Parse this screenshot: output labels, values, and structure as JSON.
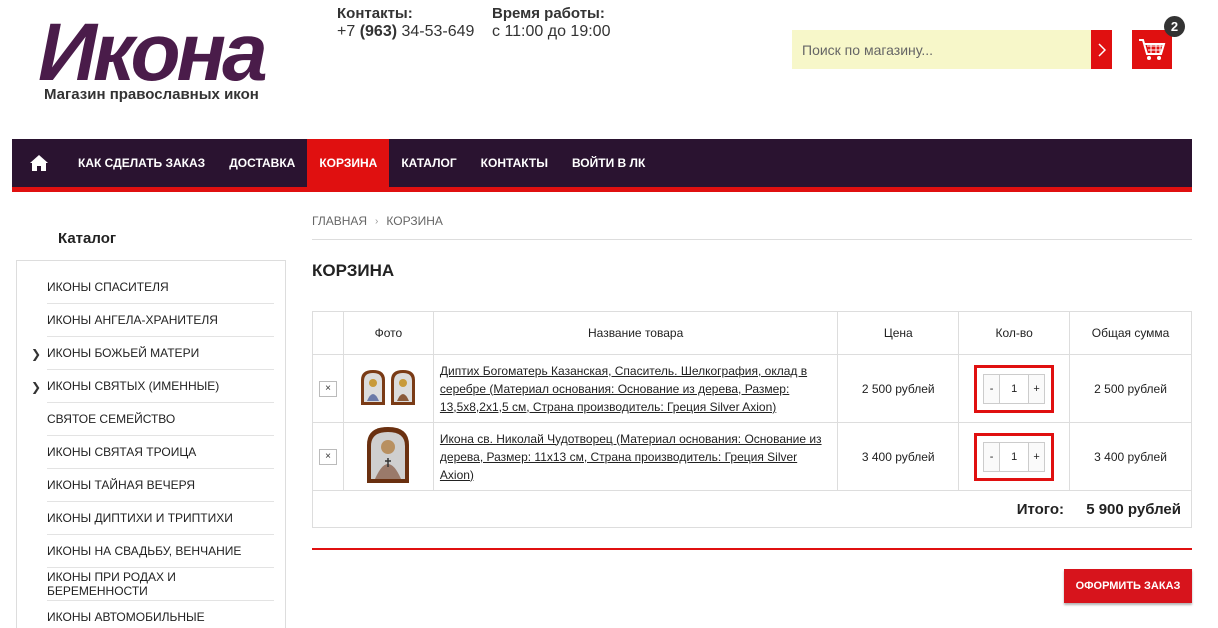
{
  "logo": {
    "title": "Икона",
    "subtitle": "Магазин православных икон"
  },
  "contacts": {
    "label": "Контакты:",
    "phone_prefix": "+7 ",
    "phone_code": "(963)",
    "phone_number": " 34-53-649"
  },
  "hours": {
    "label": "Время работы:",
    "value": "с 11:00 до 19:00"
  },
  "search": {
    "placeholder": "Поиск по магазину..."
  },
  "cart": {
    "count": "2"
  },
  "nav": {
    "items": [
      {
        "label": "КАК СДЕЛАТЬ ЗАКАЗ"
      },
      {
        "label": "ДОСТАВКА"
      },
      {
        "label": "КОРЗИНА"
      },
      {
        "label": "КАТАЛОГ"
      },
      {
        "label": "КОНТАКТЫ"
      },
      {
        "label": "ВОЙТИ В ЛК"
      }
    ]
  },
  "sidebar": {
    "title": "Каталог",
    "items": [
      {
        "label": "ИКОНЫ СПАСИТЕЛЯ"
      },
      {
        "label": "ИКОНЫ АНГЕЛА-ХРАНИТЕЛЯ"
      },
      {
        "label": "ИКОНЫ БОЖЬЕЙ МАТЕРИ"
      },
      {
        "label": "ИКОНЫ СВЯТЫХ (ИМЕННЫЕ)"
      },
      {
        "label": "СВЯТОЕ СЕМЕЙСТВО"
      },
      {
        "label": "ИКОНЫ СВЯТАЯ ТРОИЦА"
      },
      {
        "label": "ИКОНЫ ТАЙНАЯ ВЕЧЕРЯ"
      },
      {
        "label": "ИКОНЫ ДИПТИХИ И ТРИПТИХИ"
      },
      {
        "label": "ИКОНЫ НА СВАДЬБУ, ВЕНЧАНИЕ"
      },
      {
        "label": "ИКОНЫ ПРИ РОДАХ И БЕРЕМЕННОСТИ"
      },
      {
        "label": "ИКОНЫ АВТОМОБИЛЬНЫЕ"
      }
    ]
  },
  "breadcrumb": {
    "home": "ГЛАВНАЯ",
    "current": "КОРЗИНА"
  },
  "page": {
    "title": "КОРЗИНА"
  },
  "table": {
    "headers": {
      "photo": "Фото",
      "name": "Название товара",
      "price": "Цена",
      "qty": "Кол-во",
      "total": "Общая сумма"
    },
    "rows": [
      {
        "name": "Диптих Богоматерь Казанская, Спаситель. Шелкография, оклад в серебре (Материал основания: Основание из дерева, Размер: 13,5х8,2х1,5 см, Страна производитель: Греция Silver Axion)",
        "price": "2 500 рублей",
        "qty": "1",
        "total": "2 500 рублей"
      },
      {
        "name": "Икона св. Николай Чудотворец (Материал основания: Основание из дерева, Размер: 11х13 см, Страна производитель: Греция Silver Axion)",
        "price": "3 400 рублей",
        "qty": "1",
        "total": "3 400 рублей"
      }
    ],
    "delete_label": "×",
    "minus": "-",
    "plus": "+",
    "total_label": "Итого:",
    "total_value": "5 900 рублей"
  },
  "order_button": "ОФОРМИТЬ ЗАКАЗ",
  "colors": {
    "accent": "#e01010",
    "nav_bg": "#2a1330",
    "logo": "#4a1c4a",
    "search_bg": "#f7f7c9"
  }
}
